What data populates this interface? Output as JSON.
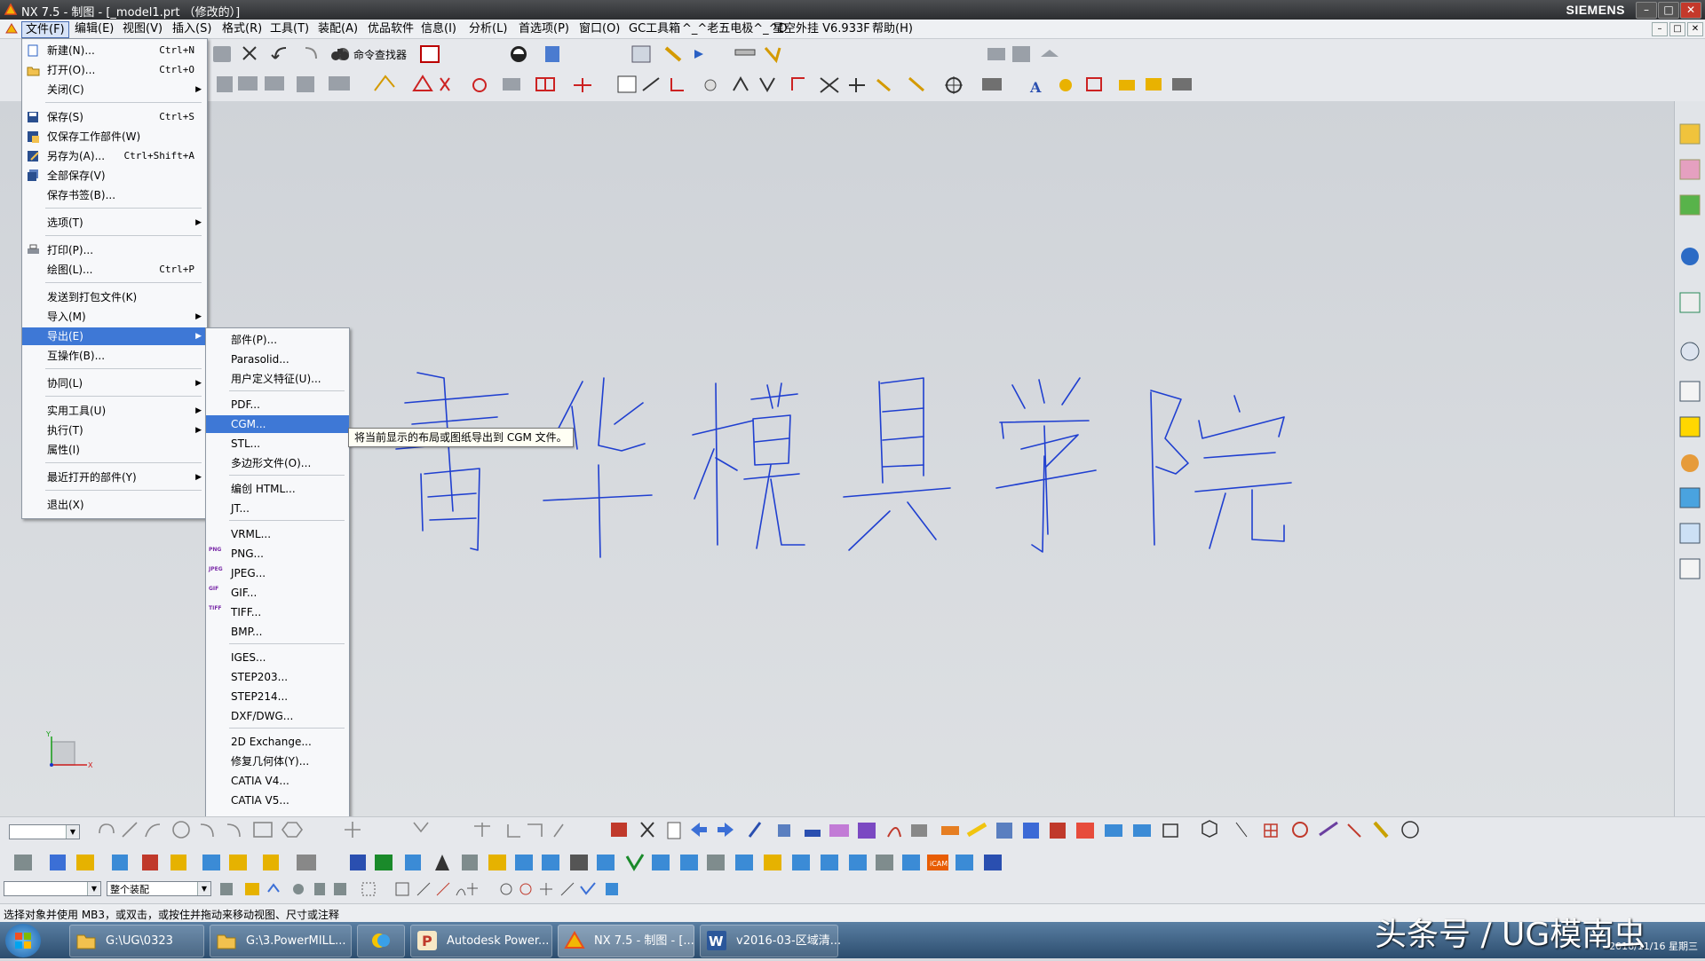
{
  "window": {
    "title": "NX 7.5 - 制图 - [_model1.prt （修改的）]",
    "brand": "SIEMENS",
    "buttons": [
      "–",
      "□",
      "✕"
    ]
  },
  "menubar": [
    "文件(F)",
    "编辑(E)",
    "视图(V)",
    "插入(S)",
    "格式(R)",
    "工具(T)",
    "装配(A)",
    "优品软件",
    "信息(I)",
    "分析(L)",
    "首选项(P)",
    "窗口(O)",
    "GC工具箱",
    "^_^老五电极^_^D",
    "星空外挂 V6.933F",
    "帮助(H)"
  ],
  "toolbar_top": {
    "command_finder": "命令查找器"
  },
  "file_menu": [
    {
      "label": "新建(N)...",
      "shortcut": "Ctrl+N",
      "icon": "new-file-icon"
    },
    {
      "label": "打开(O)...",
      "shortcut": "Ctrl+O",
      "icon": "open-folder-icon"
    },
    {
      "label": "关闭(C)",
      "arrow": true
    },
    {
      "sep": true
    },
    {
      "label": "保存(S)",
      "shortcut": "Ctrl+S",
      "icon": "save-icon"
    },
    {
      "label": "仅保存工作部件(W)",
      "icon": "save-work-part-icon"
    },
    {
      "label": "另存为(A)...",
      "shortcut": "Ctrl+Shift+A",
      "icon": "save-as-icon"
    },
    {
      "label": "全部保存(V)",
      "icon": "save-all-icon"
    },
    {
      "label": "保存书签(B)..."
    },
    {
      "sep": true
    },
    {
      "label": "选项(T)",
      "arrow": true
    },
    {
      "sep": true
    },
    {
      "label": "打印(P)...",
      "icon": "print-icon"
    },
    {
      "label": "绘图(L)...",
      "shortcut": "Ctrl+P"
    },
    {
      "sep": true
    },
    {
      "label": "发送到打包文件(K)"
    },
    {
      "label": "导入(M)",
      "arrow": true
    },
    {
      "label": "导出(E)",
      "arrow": true,
      "highlight": true
    },
    {
      "label": "互操作(B)..."
    },
    {
      "sep": true
    },
    {
      "label": "协同(L)",
      "arrow": true
    },
    {
      "sep": true
    },
    {
      "label": "实用工具(U)",
      "arrow": true
    },
    {
      "label": "执行(T)",
      "arrow": true
    },
    {
      "label": "属性(I)"
    },
    {
      "sep": true
    },
    {
      "label": "最近打开的部件(Y)",
      "arrow": true
    },
    {
      "sep": true
    },
    {
      "label": "退出(X)"
    }
  ],
  "export_menu": [
    {
      "label": "部件(P)..."
    },
    {
      "label": "Parasolid..."
    },
    {
      "label": "用户定义特征(U)..."
    },
    {
      "sep": true
    },
    {
      "label": "PDF..."
    },
    {
      "label": "CGM...",
      "highlight": true
    },
    {
      "label": "STL..."
    },
    {
      "label": "多边形文件(O)..."
    },
    {
      "sep": true
    },
    {
      "label": "编创 HTML..."
    },
    {
      "label": "JT..."
    },
    {
      "sep": true
    },
    {
      "label": "VRML..."
    },
    {
      "label": "PNG...",
      "icon": "PNG"
    },
    {
      "label": "JPEG...",
      "icon": "JPEG"
    },
    {
      "label": "GIF...",
      "icon": "GIF"
    },
    {
      "label": "TIFF...",
      "icon": "TIFF"
    },
    {
      "label": "BMP..."
    },
    {
      "sep": true
    },
    {
      "label": "IGES..."
    },
    {
      "label": "STEP203..."
    },
    {
      "label": "STEP214..."
    },
    {
      "label": "DXF/DWG..."
    },
    {
      "sep": true
    },
    {
      "label": "2D Exchange..."
    },
    {
      "label": "修复几何体(Y)..."
    },
    {
      "label": "CATIA V4..."
    },
    {
      "label": "CATIA V5..."
    }
  ],
  "tooltip": "将当前显示的布局或图纸导出到 CGM 文件。",
  "bottom_toolbar": {
    "filter_value": "",
    "scope_value": "整个装配"
  },
  "status": "选择对象并使用 MB3，或双击，或按住并拖动来移动视图、尺寸或注释",
  "taskbar": {
    "tasks": [
      {
        "label": "G:\\UG\\0323",
        "icon": "folder-icon"
      },
      {
        "label": "G:\\3.PowerMILL...",
        "icon": "folder-icon"
      },
      {
        "label": "",
        "icon": "messenger-icon"
      },
      {
        "label": "Autodesk Power...",
        "icon": "powermill-icon"
      },
      {
        "label": "NX 7.5 - 制图 - [...",
        "icon": "nx-icon",
        "active": true
      },
      {
        "label": "v2016-03-区域清...",
        "icon": "word-icon"
      }
    ],
    "clock_date": "2016/11/16 星期三"
  },
  "watermark": "头条号 / UG模南虫",
  "colors": {
    "menu_highlight": "#3e78d6",
    "canvas": "#d4d7dc",
    "ink": "#1f3fd0"
  }
}
